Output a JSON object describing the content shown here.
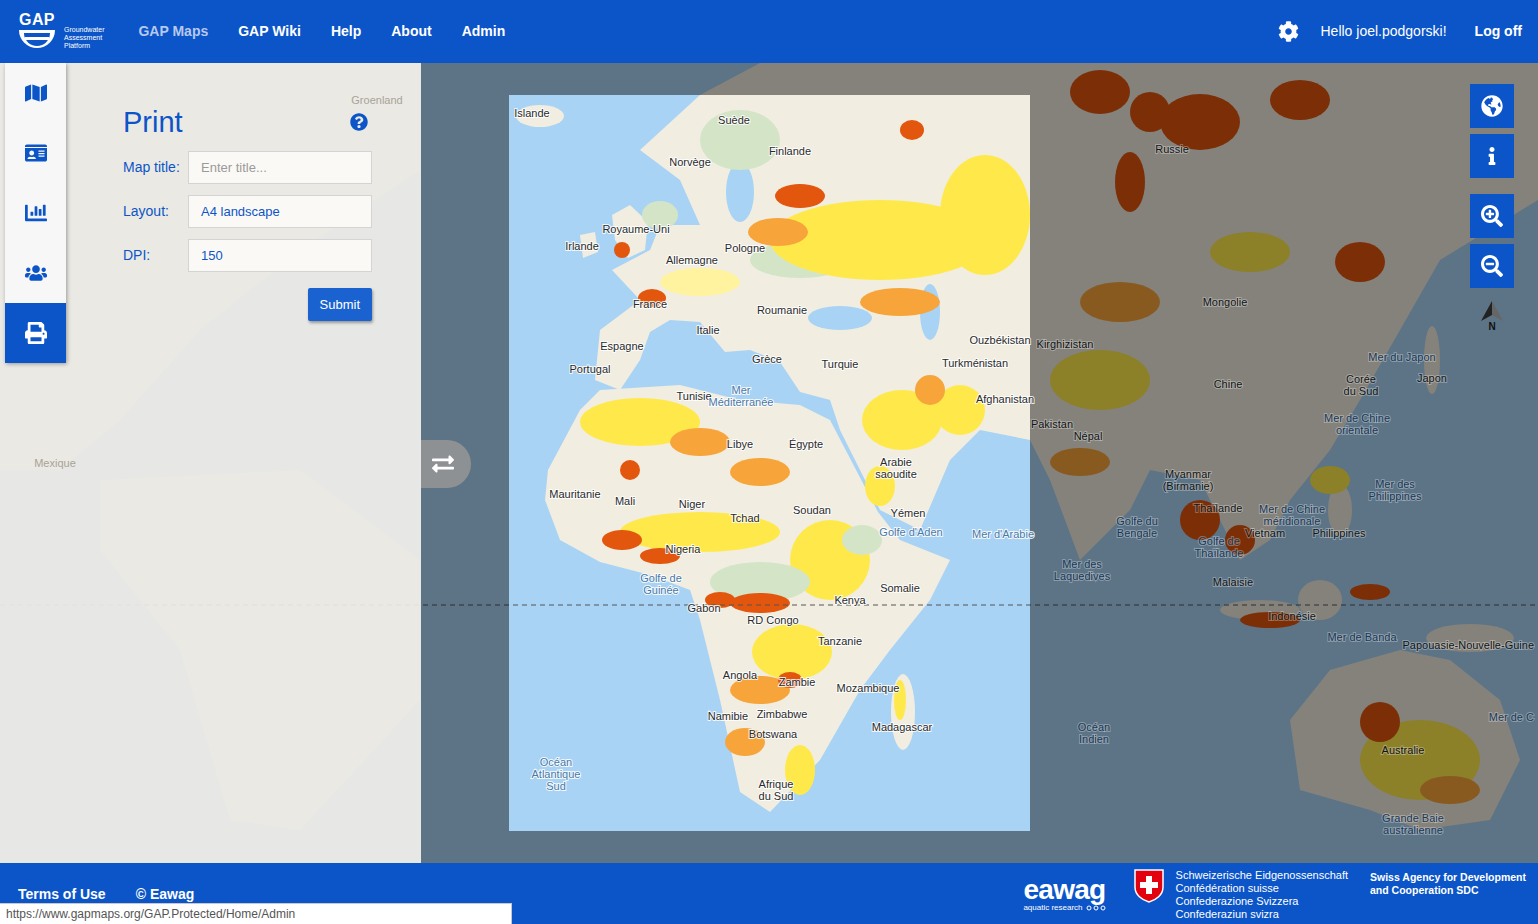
{
  "header": {
    "logo": {
      "title": "GAP",
      "subtitle": [
        "Groundwater",
        "Assessment",
        "Platform"
      ]
    },
    "nav": [
      {
        "label": "GAP Maps",
        "selected": true
      },
      {
        "label": "GAP Wiki",
        "selected": false
      },
      {
        "label": "Help",
        "selected": false
      },
      {
        "label": "About",
        "selected": false
      },
      {
        "label": "Admin",
        "selected": false
      }
    ],
    "greeting": "Hello joel.podgorski!",
    "logoff": "Log off"
  },
  "sidebar": {
    "items": [
      {
        "selected": false
      },
      {
        "selected": false
      },
      {
        "selected": false
      },
      {
        "selected": false
      },
      {
        "selected": true
      }
    ]
  },
  "print_panel": {
    "title": "Print",
    "fields": [
      {
        "label": "Map title:",
        "value": "",
        "placeholder": "Enter title..."
      },
      {
        "label": "Layout:",
        "value": "A4 landscape",
        "placeholder": ""
      },
      {
        "label": "DPI:",
        "value": "150",
        "placeholder": ""
      }
    ],
    "submit": "Submit"
  },
  "map": {
    "north": "N",
    "labels": [
      {
        "lines": [
          "Islande"
        ],
        "kind": "country",
        "in_print_area": true
      },
      {
        "lines": [
          "Suède"
        ],
        "kind": "country",
        "in_print_area": true
      },
      {
        "lines": [
          "Finlande"
        ],
        "kind": "country",
        "in_print_area": true
      },
      {
        "lines": [
          "Norvège"
        ],
        "kind": "country",
        "in_print_area": true
      },
      {
        "lines": [
          "Royaume-Uni"
        ],
        "kind": "country",
        "in_print_area": true
      },
      {
        "lines": [
          "Irlande"
        ],
        "kind": "country",
        "in_print_area": true
      },
      {
        "lines": [
          "Allemagne"
        ],
        "kind": "country",
        "in_print_area": true
      },
      {
        "lines": [
          "Pologne"
        ],
        "kind": "country",
        "in_print_area": true
      },
      {
        "lines": [
          "France"
        ],
        "kind": "country",
        "in_print_area": true
      },
      {
        "lines": [
          "Roumanie"
        ],
        "kind": "country",
        "in_print_area": true
      },
      {
        "lines": [
          "Italie"
        ],
        "kind": "country",
        "in_print_area": true
      },
      {
        "lines": [
          "Espagne"
        ],
        "kind": "country",
        "in_print_area": true
      },
      {
        "lines": [
          "Portugal"
        ],
        "kind": "country",
        "in_print_area": true
      },
      {
        "lines": [
          "Grèce"
        ],
        "kind": "country",
        "in_print_area": true
      },
      {
        "lines": [
          "Turquie"
        ],
        "kind": "country",
        "in_print_area": true
      },
      {
        "lines": [
          "Ouzbékistan"
        ],
        "kind": "country",
        "in_print_area": true
      },
      {
        "lines": [
          "Turkménistan"
        ],
        "kind": "country",
        "in_print_area": true
      },
      {
        "lines": [
          "Afghanistan"
        ],
        "kind": "country",
        "in_print_area": true
      },
      {
        "lines": [
          "Tunisie"
        ],
        "kind": "country",
        "in_print_area": true
      },
      {
        "lines": [
          "Mer",
          "Méditerranée"
        ],
        "kind": "water",
        "in_print_area": true
      },
      {
        "lines": [
          "Libye"
        ],
        "kind": "country",
        "in_print_area": true
      },
      {
        "lines": [
          "Égypte"
        ],
        "kind": "country",
        "in_print_area": true
      },
      {
        "lines": [
          "Arabie",
          "saoudite"
        ],
        "kind": "country",
        "in_print_area": true
      },
      {
        "lines": [
          "Mauritanie"
        ],
        "kind": "country",
        "in_print_area": true
      },
      {
        "lines": [
          "Mali"
        ],
        "kind": "country",
        "in_print_area": true
      },
      {
        "lines": [
          "Niger"
        ],
        "kind": "country",
        "in_print_area": true
      },
      {
        "lines": [
          "Tchad"
        ],
        "kind": "country",
        "in_print_area": true
      },
      {
        "lines": [
          "Soudan"
        ],
        "kind": "country",
        "in_print_area": true
      },
      {
        "lines": [
          "Yémen"
        ],
        "kind": "country",
        "in_print_area": true
      },
      {
        "lines": [
          "Golfe d'Aden"
        ],
        "kind": "water",
        "in_print_area": true
      },
      {
        "lines": [
          "Mer d'Arabie"
        ],
        "kind": "water",
        "in_print_area": true
      },
      {
        "lines": [
          "Nigeria"
        ],
        "kind": "country",
        "in_print_area": true
      },
      {
        "lines": [
          "Golfe de",
          "Guinée"
        ],
        "kind": "water",
        "in_print_area": true
      },
      {
        "lines": [
          "Gabon"
        ],
        "kind": "country",
        "in_print_area": true
      },
      {
        "lines": [
          "RD Congo"
        ],
        "kind": "country",
        "in_print_area": true
      },
      {
        "lines": [
          "Kenya"
        ],
        "kind": "country",
        "in_print_area": true
      },
      {
        "lines": [
          "Somalie"
        ],
        "kind": "country",
        "in_print_area": true
      },
      {
        "lines": [
          "Tanzanie"
        ],
        "kind": "country",
        "in_print_area": true
      },
      {
        "lines": [
          "Angola"
        ],
        "kind": "country",
        "in_print_area": true
      },
      {
        "lines": [
          "Zambie"
        ],
        "kind": "country",
        "in_print_area": true
      },
      {
        "lines": [
          "Mozambique"
        ],
        "kind": "country",
        "in_print_area": true
      },
      {
        "lines": [
          "Namibie"
        ],
        "kind": "country",
        "in_print_area": true
      },
      {
        "lines": [
          "Zimbabwe"
        ],
        "kind": "country",
        "in_print_area": true
      },
      {
        "lines": [
          "Madagascar"
        ],
        "kind": "country",
        "in_print_area": true
      },
      {
        "lines": [
          "Botswana"
        ],
        "kind": "country",
        "in_print_area": true
      },
      {
        "lines": [
          "Afrique",
          "du Sud"
        ],
        "kind": "country",
        "in_print_area": true
      },
      {
        "lines": [
          "Océan",
          "Atlantique",
          "Sud"
        ],
        "kind": "water",
        "in_print_area": true
      },
      {
        "lines": [
          "Pakistan"
        ],
        "kind": "country",
        "in_print_area": false
      },
      {
        "lines": [
          "Russie"
        ],
        "kind": "country",
        "in_print_area": false
      },
      {
        "lines": [
          "Mongolie"
        ],
        "kind": "country",
        "in_print_area": false
      },
      {
        "lines": [
          "Kirghizistan"
        ],
        "kind": "country",
        "in_print_area": false
      },
      {
        "lines": [
          "Chine"
        ],
        "kind": "country",
        "in_print_area": false
      },
      {
        "lines": [
          "Corée",
          "du Sud"
        ],
        "kind": "country",
        "in_print_area": false
      },
      {
        "lines": [
          "Japon"
        ],
        "kind": "country",
        "in_print_area": false
      },
      {
        "lines": [
          "Mer du Japon"
        ],
        "kind": "water",
        "in_print_area": false
      },
      {
        "lines": [
          "Mer de Chine",
          "orientale"
        ],
        "kind": "water",
        "in_print_area": false
      },
      {
        "lines": [
          "Népal"
        ],
        "kind": "country",
        "in_print_area": false
      },
      {
        "lines": [
          "Golfe du",
          "Bengale"
        ],
        "kind": "water",
        "in_print_area": false
      },
      {
        "lines": [
          "Myanmar",
          "(Birmanie)"
        ],
        "kind": "country",
        "in_print_area": false
      },
      {
        "lines": [
          "Thaïlande"
        ],
        "kind": "country",
        "in_print_area": false
      },
      {
        "lines": [
          "Golfe de",
          "Thaïlande"
        ],
        "kind": "water",
        "in_print_area": false
      },
      {
        "lines": [
          "Vietnam"
        ],
        "kind": "country",
        "in_print_area": false
      },
      {
        "lines": [
          "Mer de Chine",
          "méridionale"
        ],
        "kind": "water",
        "in_print_area": false
      },
      {
        "lines": [
          "Mer des",
          "Philippines"
        ],
        "kind": "water",
        "in_print_area": false
      },
      {
        "lines": [
          "Philippines"
        ],
        "kind": "country",
        "in_print_area": false
      },
      {
        "lines": [
          "Mer des",
          "Laquedives"
        ],
        "kind": "water",
        "in_print_area": false
      },
      {
        "lines": [
          "Malaisie"
        ],
        "kind": "country",
        "in_print_area": false
      },
      {
        "lines": [
          "Indonésie"
        ],
        "kind": "country",
        "in_print_area": false
      },
      {
        "lines": [
          "Mer de Banda"
        ],
        "kind": "water",
        "in_print_area": false
      },
      {
        "lines": [
          "Papouasie-Nouvelle-Guine"
        ],
        "kind": "country",
        "in_print_area": false
      },
      {
        "lines": [
          "Océan",
          "Indien"
        ],
        "kind": "water",
        "in_print_area": false
      },
      {
        "lines": [
          "Australie"
        ],
        "kind": "country",
        "in_print_area": false
      },
      {
        "lines": [
          "Grande Baie",
          "australienne"
        ],
        "kind": "water",
        "in_print_area": false
      },
      {
        "lines": [
          "Mer de C"
        ],
        "kind": "water",
        "in_print_area": false
      },
      {
        "lines": [
          "Groenland"
        ],
        "kind": "faint",
        "in_print_area": false
      },
      {
        "lines": [
          "Mexique"
        ],
        "kind": "faint",
        "in_print_area": false
      }
    ]
  },
  "footer": {
    "terms": "Terms of Use",
    "copyright": "© Eawag",
    "eawag": {
      "name": "eawag",
      "tagline": "aquatic research"
    },
    "confederation": [
      "Schweizerische Eidgenossenschaft",
      "Confédération suisse",
      "Confederazione Svizzera",
      "Confederaziun svizra"
    ],
    "sdc": [
      "Swiss Agency for Development",
      "and Cooperation SDC"
    ]
  },
  "status_bar": {
    "url": "https://www.gapmaps.org/GAP.Protected/Home/Admin"
  }
}
